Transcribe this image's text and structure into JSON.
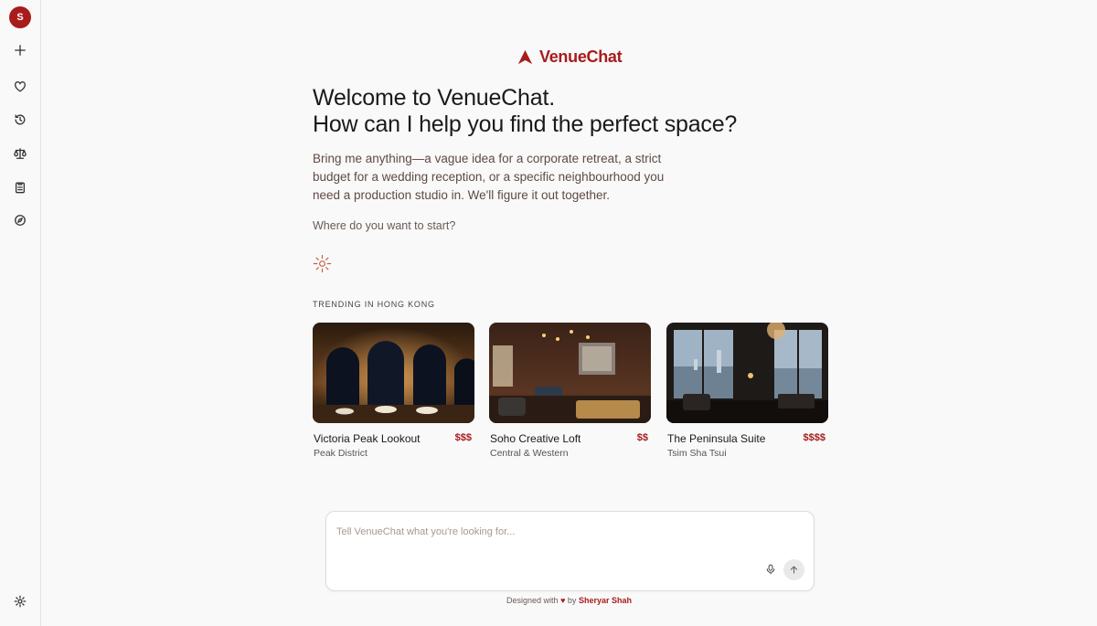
{
  "sidebar": {
    "avatar_initial": "S",
    "icons": [
      "plus-icon",
      "heart-icon",
      "history-icon",
      "scale-icon",
      "clipboard-icon",
      "compass-icon",
      "gear-icon"
    ]
  },
  "brand": {
    "name": "VenueChat",
    "accent": "#a81c1c"
  },
  "hero": {
    "line1": "Welcome to VenueChat.",
    "line2": "How can I help you find the perfect space?",
    "intro": "Bring me anything—a vague idea for a corporate retreat, a strict budget for a wedding reception, or a specific neighbourhood you need a production studio in. We'll figure it out together.",
    "question": "Where do you want to start?"
  },
  "trending": {
    "label": "TRENDING IN HONG KONG",
    "cards": [
      {
        "name": "Victoria Peak Lookout",
        "price": "$$$",
        "area": "Peak District"
      },
      {
        "name": "Soho Creative Loft",
        "price": "$$",
        "area": "Central & Western"
      },
      {
        "name": "The Peninsula Suite",
        "price": "$$$$",
        "area": "Tsim Sha Tsui"
      }
    ]
  },
  "chat": {
    "placeholder": "Tell VenueChat what you're looking for..."
  },
  "footer": {
    "prefix": "Designed with",
    "heart": "♥",
    "by": "by",
    "author": "Sheryar Shah"
  }
}
